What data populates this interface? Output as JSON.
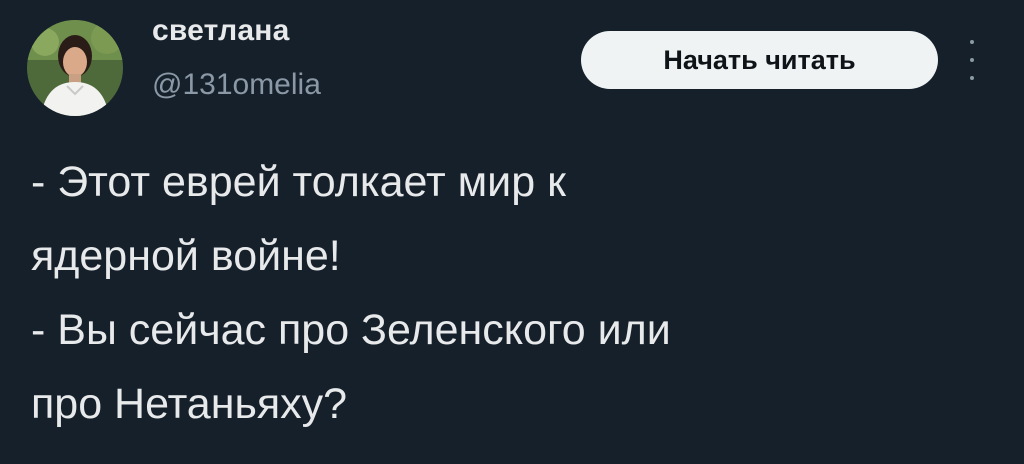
{
  "author": {
    "display_name": "светлана",
    "handle": "@131omelia",
    "avatar_icon": "user-photo-avatar"
  },
  "actions": {
    "subscribe_label": "Начать читать",
    "more_icon": "more-vertical-icon"
  },
  "tweet": {
    "lines": [
      "- Этот еврей толкает мир к",
      "ядерной войне!",
      "- Вы сейчас про Зеленского или",
      "про Нетаньяху?"
    ]
  },
  "colors": {
    "background": "#15202b",
    "primary_text": "#e7e9ea",
    "secondary_text": "#8b98a5",
    "button_bg": "#eff3f4",
    "button_text": "#0f1419"
  }
}
